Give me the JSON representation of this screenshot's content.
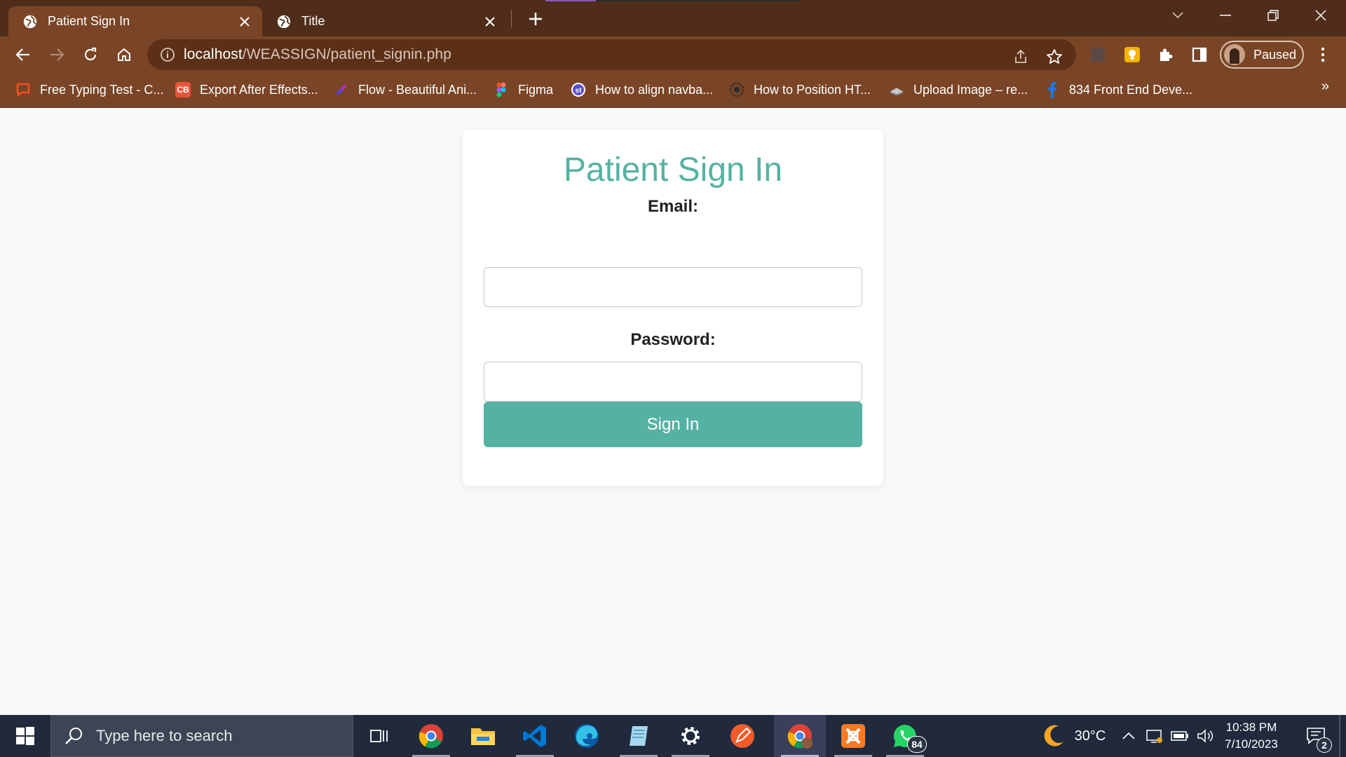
{
  "browser": {
    "tabs": [
      {
        "title": "Patient Sign In",
        "active": true
      },
      {
        "title": "Title",
        "active": false
      }
    ],
    "url": {
      "host": "localhost",
      "path": "/WEASSIGN/patient_signin.php"
    },
    "profile_label": "Paused",
    "bookmarks": [
      {
        "label": "Free Typing Test - C...",
        "icon": "chat-bubble-icon",
        "color": "#f25022"
      },
      {
        "label": "Export After Effects...",
        "icon": "cb-icon",
        "color": "#e8553a"
      },
      {
        "label": "Flow - Beautiful Ani...",
        "icon": "flow-icon",
        "color": "#7b2ff7"
      },
      {
        "label": "Figma",
        "icon": "figma-icon",
        "color": "#a259ff"
      },
      {
        "label": "How to align navba...",
        "icon": "st-icon",
        "color": "#5a4fcf"
      },
      {
        "label": "How to Position HT...",
        "icon": "gear-logo-icon",
        "color": "#555555"
      },
      {
        "label": "Upload Image – re...",
        "icon": "cloud-icon",
        "color": "#8a8a9a"
      },
      {
        "label": "834 Front End Deve...",
        "icon": "facebook-icon",
        "color": "#1877f2"
      }
    ]
  },
  "page": {
    "title": "Patient Sign In",
    "email_label": "Email:",
    "email_value": "",
    "password_label": "Password:",
    "password_value": "",
    "submit_label": "Sign In",
    "accent_color": "#55b2a2"
  },
  "taskbar": {
    "search_placeholder": "Type here to search",
    "apps": [
      "task-view",
      "chrome",
      "file-explorer",
      "vscode",
      "edge",
      "notepad",
      "settings",
      "pen-app",
      "chrome-profile",
      "xampp",
      "whatsapp"
    ],
    "whatsapp_badge": "84",
    "weather": "30°C",
    "time": "10:38 PM",
    "date": "7/10/2023",
    "notifications": "2"
  }
}
